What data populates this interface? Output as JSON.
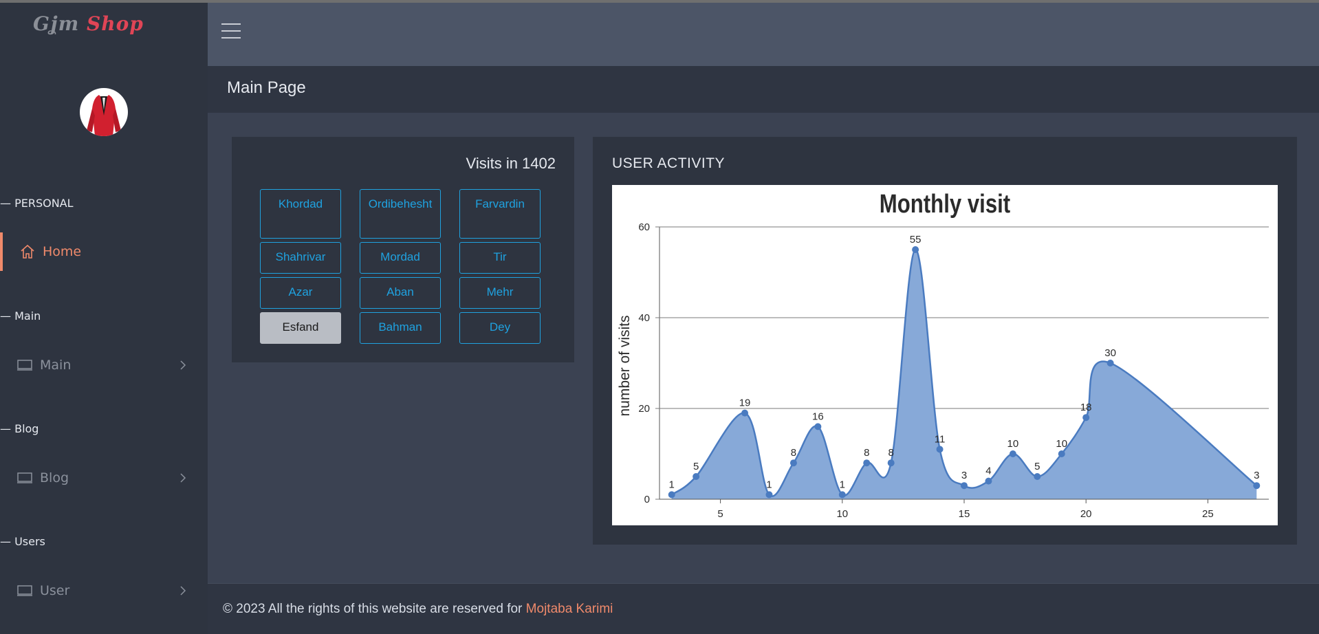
{
  "brand": {
    "logo_part1": "Gʝт",
    "logo_part2": "Shop"
  },
  "sidebar": {
    "sections": [
      {
        "label": "— PERSONAL"
      },
      {
        "label": "— Main"
      },
      {
        "label": "— Blog"
      },
      {
        "label": "— Users"
      }
    ],
    "items": [
      {
        "label": "Home",
        "icon": "home-icon",
        "active": true
      },
      {
        "label": "Main",
        "icon": "monitor-icon"
      },
      {
        "label": "Blog",
        "icon": "monitor-icon"
      },
      {
        "label": "User",
        "icon": "monitor-icon"
      }
    ]
  },
  "header": {
    "page_title": "Main Page"
  },
  "visits_card": {
    "title": "Visits in 1402",
    "months": [
      {
        "label": "Khordad"
      },
      {
        "label": "Ordibehesht"
      },
      {
        "label": "Farvardin"
      },
      {
        "label": "Shahrivar"
      },
      {
        "label": "Mordad"
      },
      {
        "label": "Tir"
      },
      {
        "label": "Azar"
      },
      {
        "label": "Aban"
      },
      {
        "label": "Mehr"
      },
      {
        "label": "Esfand",
        "active": true
      },
      {
        "label": "Bahman"
      },
      {
        "label": "Dey"
      }
    ]
  },
  "activity_card": {
    "title": "USER ACTIVITY"
  },
  "chart_data": {
    "type": "area",
    "title": "Monthly visit",
    "xlabel": "",
    "ylabel": "number of visits",
    "x": [
      3,
      4,
      6,
      7,
      8,
      9,
      10,
      11,
      12,
      13,
      14,
      15,
      16,
      17,
      18,
      19,
      20,
      21,
      27
    ],
    "y": [
      1,
      5,
      19,
      1,
      8,
      16,
      1,
      8,
      8,
      55,
      11,
      3,
      4,
      10,
      5,
      10,
      18,
      30,
      3
    ],
    "xlim": [
      2.5,
      27.5
    ],
    "ylim": [
      0,
      60
    ],
    "x_ticks": [
      5,
      10,
      15,
      20,
      25
    ],
    "y_ticks": [
      0,
      20,
      40,
      60
    ],
    "grid": "horizontal",
    "fill_color": "#87a9d8",
    "line_color": "#4a7bc0"
  },
  "footer": {
    "text": "© 2023 All the rights of this website are reserved for",
    "author": "Mojtaba Karimi"
  },
  "colors": {
    "accent": "#f08a6b",
    "link": "#1fa2e0",
    "sidebar": "#2e3440"
  }
}
